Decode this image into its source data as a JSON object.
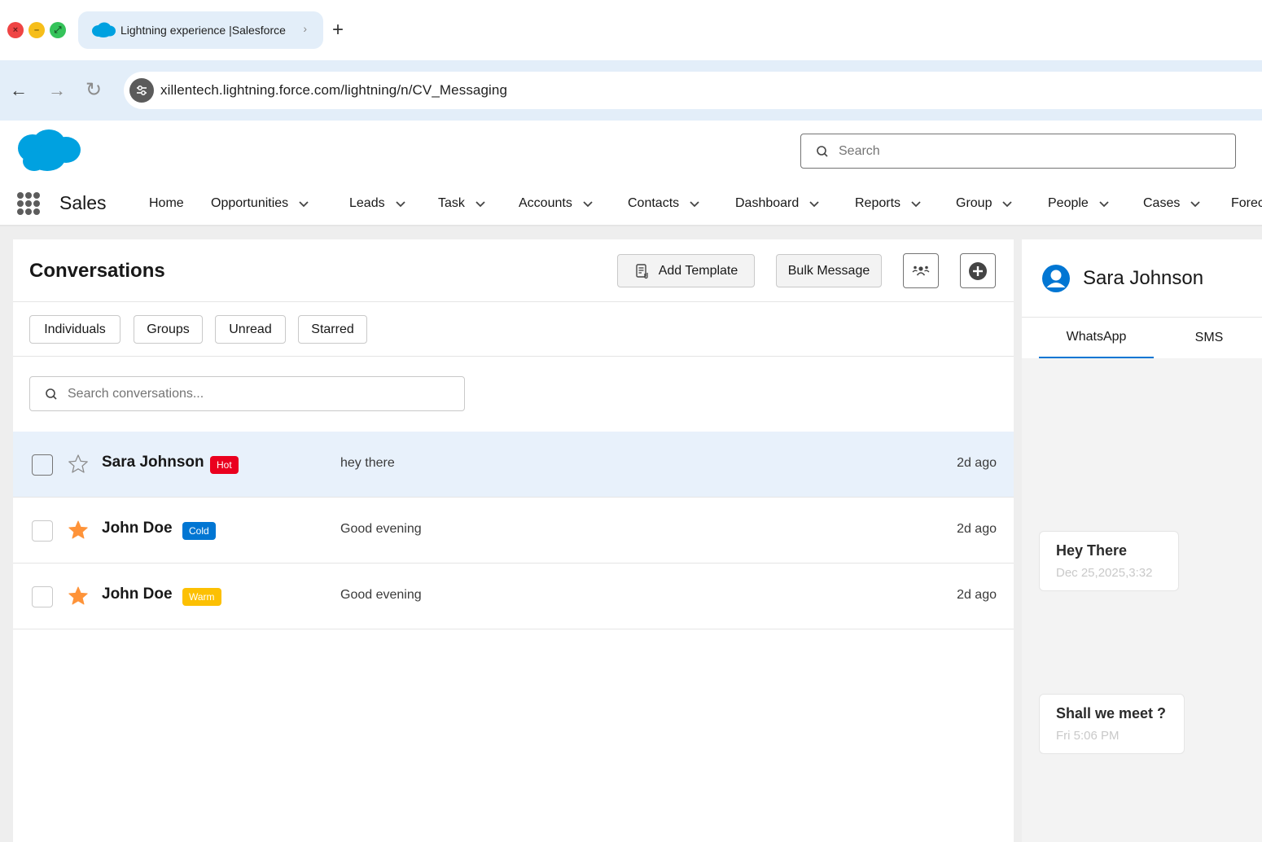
{
  "browser": {
    "tab_title": "Lightning experience",
    "tab_site": "Salesforce",
    "url": "xillentech.lightning.force.com/lightning/n/CV_Messaging"
  },
  "header": {
    "search_placeholder": "Search"
  },
  "nav": {
    "app_name": "Sales",
    "items": [
      {
        "label": "Home",
        "dropdown": false
      },
      {
        "label": "Opportunities",
        "dropdown": true
      },
      {
        "label": "Leads",
        "dropdown": true
      },
      {
        "label": "Task",
        "dropdown": true
      },
      {
        "label": "Accounts",
        "dropdown": true
      },
      {
        "label": "Contacts",
        "dropdown": true
      },
      {
        "label": "Dashboard",
        "dropdown": true
      },
      {
        "label": "Reports",
        "dropdown": true
      },
      {
        "label": "Group",
        "dropdown": true
      },
      {
        "label": "People",
        "dropdown": true
      },
      {
        "label": "Cases",
        "dropdown": true
      },
      {
        "label": "Forec",
        "dropdown": false
      }
    ]
  },
  "conversations": {
    "title": "Conversations",
    "add_template_label": "Add Template",
    "bulk_message_label": "Bulk Message",
    "filters": [
      "Individuals",
      "Groups",
      "Unread",
      "Starred"
    ],
    "search_placeholder": "Search conversations...",
    "rows": [
      {
        "name": "Sara Johnson",
        "badge": "Hot",
        "badge_color": "#ea001e",
        "message": "hey there",
        "time": "2d ago",
        "starred": false,
        "selected": true
      },
      {
        "name": "John Doe",
        "badge": "Cold",
        "badge_color": "#0176d3",
        "message": "Good evening",
        "time": "2d ago",
        "starred": true,
        "selected": false
      },
      {
        "name": "John Doe",
        "badge": "Warm",
        "badge_color": "#fcc003",
        "message": "Good evening",
        "time": "2d ago",
        "starred": true,
        "selected": false
      }
    ]
  },
  "chat": {
    "contact_name": "Sara Johnson",
    "tabs": [
      "WhatsApp",
      "SMS"
    ],
    "active_tab": "WhatsApp",
    "messages": [
      {
        "text": "Hey There",
        "time": "Dec 25,2025,3:32"
      },
      {
        "text": "Shall we meet ?",
        "time": "Fri 5:06 PM"
      }
    ]
  },
  "colors": {
    "brand": "#0176d3",
    "salesforce_cloud": "#00a1e0",
    "star_filled": "#fe9339",
    "selected_row": "#e8f1fb"
  }
}
